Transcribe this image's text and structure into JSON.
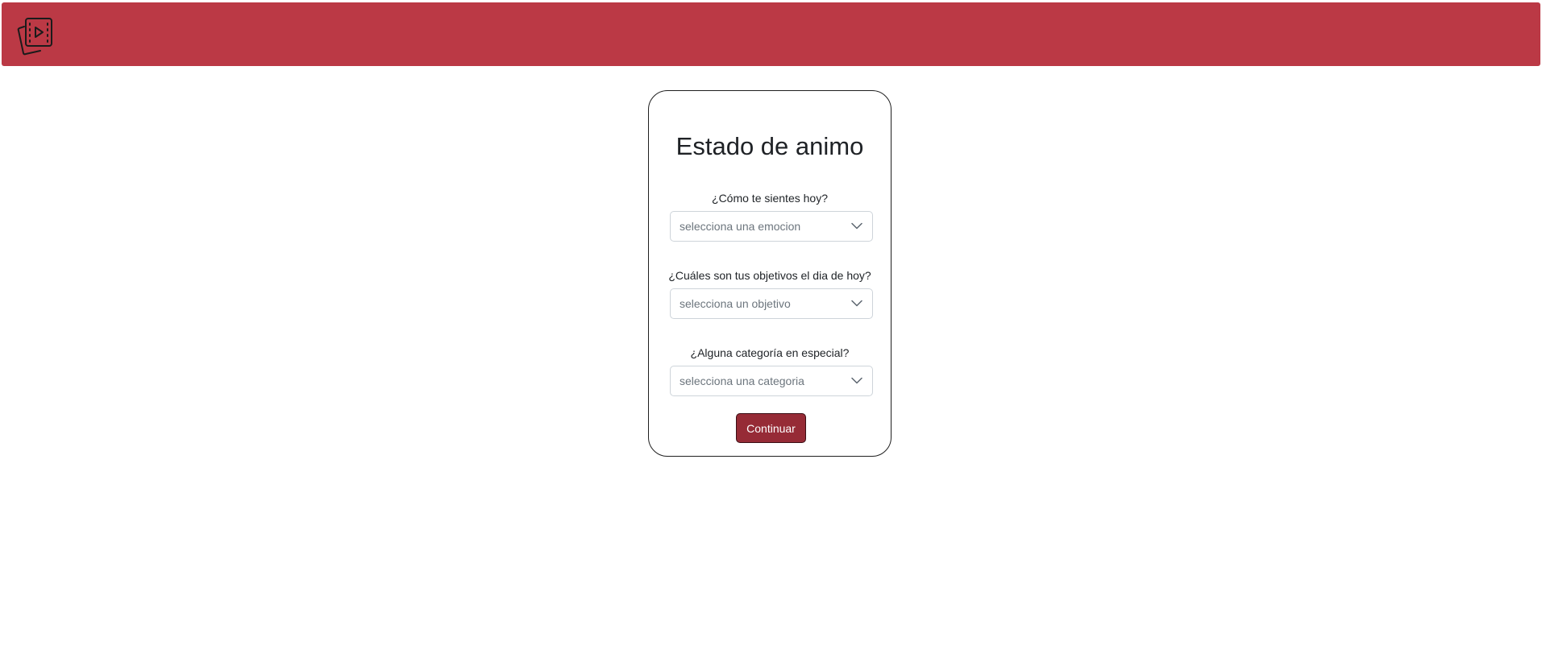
{
  "header": {
    "background_color": "#bb3945",
    "logo_icon": "film-stack-icon"
  },
  "form": {
    "title": "Estado de animo",
    "fields": [
      {
        "label": "¿Cómo te sientes hoy?",
        "placeholder": "selecciona una emocion"
      },
      {
        "label": "¿Cuáles son tus objetivos el dia de hoy?",
        "placeholder": "selecciona un objetivo"
      },
      {
        "label": "¿Alguna categoría en especial?",
        "placeholder": "selecciona una categoria"
      }
    ],
    "submit_label": "Continuar",
    "submit_color": "#962b36"
  }
}
